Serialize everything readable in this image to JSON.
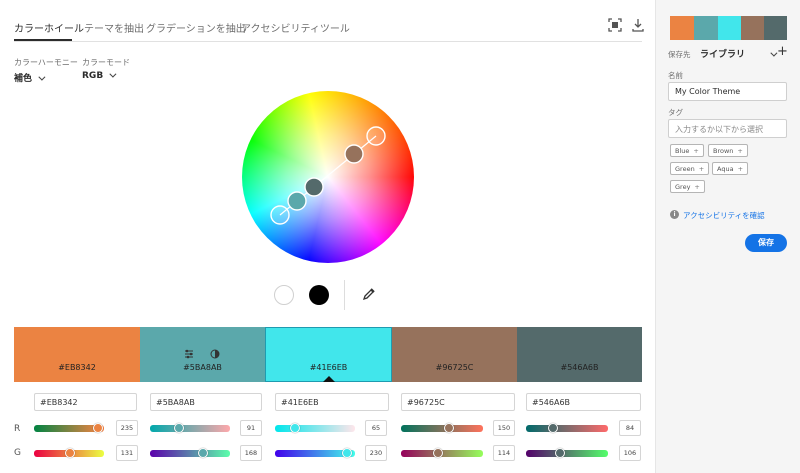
{
  "tabs": [
    {
      "label": "カラーホイール"
    },
    {
      "label": "テーマを抽出"
    },
    {
      "label": "グラデーションを抽出"
    },
    {
      "label": "アクセシビリティツール"
    }
  ],
  "harmony": {
    "label": "カラーハーモニー",
    "value": "補色"
  },
  "color_mode": {
    "label": "カラーモード",
    "value": "RGB"
  },
  "swatches": [
    {
      "hex": "#EB8342",
      "color": "#eb8342",
      "r": 235,
      "g": 131
    },
    {
      "hex": "#5BA8AB",
      "color": "#5ba8ab",
      "r": 91,
      "g": 168
    },
    {
      "hex": "#41E6EB",
      "color": "#41e6eb",
      "r": 65,
      "g": 230
    },
    {
      "hex": "#96725C",
      "color": "#96725c",
      "r": 150,
      "g": 114
    },
    {
      "hex": "#546A6B",
      "color": "#546a6b",
      "r": 84,
      "g": 106
    }
  ],
  "channels": {
    "r_label": "R",
    "g_label": "G"
  },
  "panel": {
    "save_to_label": "保存先",
    "save_to_value": "ライブラリ",
    "name_label": "名前",
    "name_value": "My Color Theme",
    "tags_label": "タグ",
    "tags_placeholder": "入力するか以下から選択",
    "tags": [
      "Blue",
      "Brown",
      "Green",
      "Aqua",
      "Grey"
    ],
    "accessibility_link": "アクセシビリティを確認",
    "save_button": "保存"
  },
  "colors": {
    "accent": "#1473e6"
  }
}
